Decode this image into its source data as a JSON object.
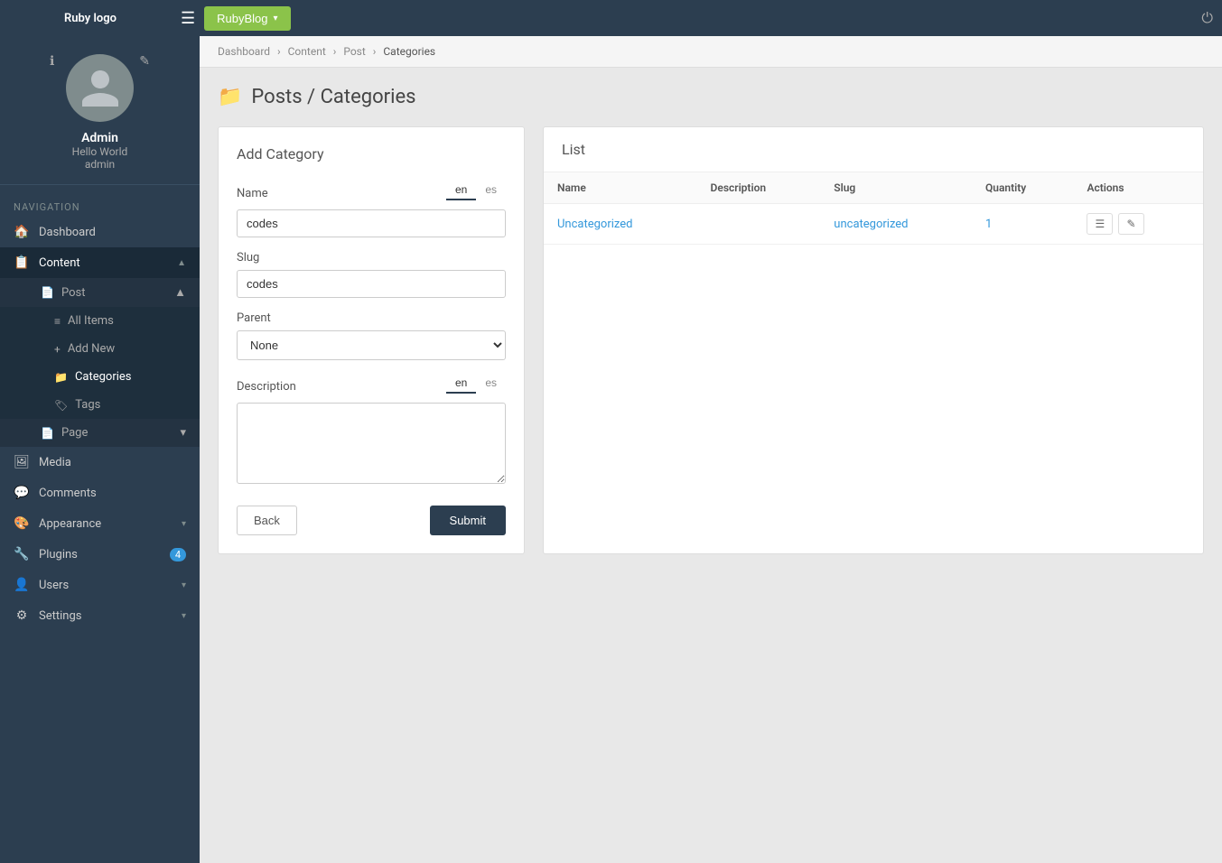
{
  "topbar": {
    "logo": "Ruby logo",
    "blog_btn": "RubyBlog",
    "blog_btn_arrow": "▾",
    "power_icon": "⏻"
  },
  "sidebar": {
    "user": {
      "name": "Admin",
      "site": "Hello World",
      "role": "admin"
    },
    "nav_label": "Navigation",
    "nav_items": [
      {
        "id": "dashboard",
        "icon": "🏠",
        "label": "Dashboard",
        "has_arrow": false
      },
      {
        "id": "content",
        "icon": "📋",
        "label": "Content",
        "has_arrow": true,
        "expanded": true
      },
      {
        "id": "media",
        "icon": "🖼",
        "label": "Media",
        "has_arrow": false
      },
      {
        "id": "comments",
        "icon": "💬",
        "label": "Comments",
        "has_arrow": false
      },
      {
        "id": "appearance",
        "icon": "🎨",
        "label": "Appearance",
        "has_arrow": true
      },
      {
        "id": "plugins",
        "icon": "🔧",
        "label": "Plugins",
        "has_arrow": false,
        "badge": "4"
      },
      {
        "id": "users",
        "icon": "👤",
        "label": "Users",
        "has_arrow": true
      },
      {
        "id": "settings",
        "icon": "⚙",
        "label": "Settings",
        "has_arrow": true
      }
    ],
    "content_sub": [
      {
        "id": "post",
        "icon": "📄",
        "label": "Post",
        "has_arrow": true,
        "expanded": true
      },
      {
        "id": "page",
        "icon": "📄",
        "label": "Page",
        "has_arrow": true
      }
    ],
    "post_sub": [
      {
        "id": "all-items",
        "icon": "≡",
        "label": "All Items"
      },
      {
        "id": "add-new",
        "icon": "+",
        "label": "Add New"
      },
      {
        "id": "categories",
        "icon": "📁",
        "label": "Categories",
        "active": true
      },
      {
        "id": "tags",
        "icon": "🏷",
        "label": "Tags"
      }
    ]
  },
  "breadcrumb": {
    "items": [
      "Dashboard",
      "Content",
      "Post",
      "Categories"
    ]
  },
  "page": {
    "title": "Posts / Categories",
    "title_icon": "📁"
  },
  "add_form": {
    "title": "Add Category",
    "name_label": "Name",
    "name_value": "codes",
    "lang_tabs": [
      "en",
      "es"
    ],
    "active_lang": "en",
    "slug_label": "Slug",
    "slug_value": "codes",
    "parent_label": "Parent",
    "parent_value": "None",
    "parent_options": [
      "None"
    ],
    "description_label": "Description",
    "description_value": "",
    "back_btn": "Back",
    "submit_btn": "Submit"
  },
  "list": {
    "title": "List",
    "columns": [
      "Name",
      "Description",
      "Slug",
      "Quantity",
      "Actions"
    ],
    "rows": [
      {
        "name": "Uncategorized",
        "description": "",
        "slug": "uncategorized",
        "quantity": "1"
      }
    ]
  }
}
